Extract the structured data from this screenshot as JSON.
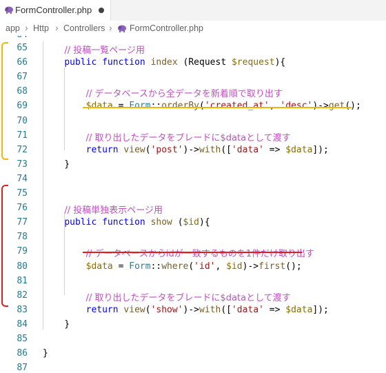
{
  "tab": {
    "label": "FormController.php"
  },
  "breadcrumb": {
    "items": [
      "app",
      "Http",
      "Controllers",
      "FormController.php"
    ]
  },
  "top_partial": "84",
  "lines": [
    {
      "num": "65",
      "tokens": [
        {
          "t": "    "
        },
        {
          "t": "// 投稿一覧ページ用",
          "c": "comment"
        }
      ]
    },
    {
      "num": "66",
      "tokens": [
        {
          "t": "    "
        },
        {
          "t": "public",
          "c": "kw"
        },
        {
          "t": " "
        },
        {
          "t": "function",
          "c": "kw"
        },
        {
          "t": " "
        },
        {
          "t": "index",
          "c": "func"
        },
        {
          "t": " ("
        },
        {
          "t": "Request",
          "c": "plain"
        },
        {
          "t": " "
        },
        {
          "t": "$request",
          "c": "var"
        },
        {
          "t": "){"
        }
      ]
    },
    {
      "num": "67",
      "tokens": []
    },
    {
      "num": "68",
      "tokens": [
        {
          "t": "        "
        },
        {
          "t": "// データベースから全データを新着順で取り出す",
          "c": "comment"
        }
      ]
    },
    {
      "num": "69",
      "tokens": [
        {
          "t": "        "
        },
        {
          "t": "$data",
          "c": "var"
        },
        {
          "t": " = "
        },
        {
          "t": "Form",
          "c": "cls"
        },
        {
          "t": "::"
        },
        {
          "t": "orderBy",
          "c": "func"
        },
        {
          "t": "("
        },
        {
          "t": "'created_at'",
          "c": "str"
        },
        {
          "t": ", "
        },
        {
          "t": "'desc'",
          "c": "str"
        },
        {
          "t": ")->"
        },
        {
          "t": "get",
          "c": "func"
        },
        {
          "t": "();"
        }
      ]
    },
    {
      "num": "70",
      "tokens": []
    },
    {
      "num": "71",
      "tokens": [
        {
          "t": "        "
        },
        {
          "t": "// 取り出したデータをブレードに$dataとして渡す",
          "c": "comment"
        }
      ]
    },
    {
      "num": "72",
      "tokens": [
        {
          "t": "        "
        },
        {
          "t": "return",
          "c": "kw"
        },
        {
          "t": " "
        },
        {
          "t": "view",
          "c": "func"
        },
        {
          "t": "("
        },
        {
          "t": "'post'",
          "c": "str"
        },
        {
          "t": ")->"
        },
        {
          "t": "with",
          "c": "func"
        },
        {
          "t": "(["
        },
        {
          "t": "'data'",
          "c": "str"
        },
        {
          "t": " => "
        },
        {
          "t": "$data",
          "c": "var"
        },
        {
          "t": "]);"
        }
      ]
    },
    {
      "num": "73",
      "tokens": [
        {
          "t": "    }"
        }
      ]
    },
    {
      "num": "74",
      "tokens": []
    },
    {
      "num": "75",
      "tokens": []
    },
    {
      "num": "76",
      "tokens": [
        {
          "t": "    "
        },
        {
          "t": "// 投稿単独表示ページ用",
          "c": "comment"
        }
      ]
    },
    {
      "num": "77",
      "tokens": [
        {
          "t": "    "
        },
        {
          "t": "public",
          "c": "kw"
        },
        {
          "t": " "
        },
        {
          "t": "function",
          "c": "kw"
        },
        {
          "t": " "
        },
        {
          "t": "show",
          "c": "func"
        },
        {
          "t": " ("
        },
        {
          "t": "$id",
          "c": "var"
        },
        {
          "t": "){"
        }
      ]
    },
    {
      "num": "78",
      "tokens": []
    },
    {
      "num": "79",
      "tokens": [
        {
          "t": "        "
        },
        {
          "t": "// データベースからidが一致するものを1件だけ取り出す",
          "c": "comment"
        }
      ]
    },
    {
      "num": "80",
      "tokens": [
        {
          "t": "        "
        },
        {
          "t": "$data",
          "c": "var"
        },
        {
          "t": " = "
        },
        {
          "t": "Form",
          "c": "cls"
        },
        {
          "t": "::"
        },
        {
          "t": "where",
          "c": "func"
        },
        {
          "t": "("
        },
        {
          "t": "'id'",
          "c": "str"
        },
        {
          "t": ", "
        },
        {
          "t": "$id",
          "c": "var"
        },
        {
          "t": ")->"
        },
        {
          "t": "first",
          "c": "func"
        },
        {
          "t": "();"
        }
      ]
    },
    {
      "num": "81",
      "tokens": []
    },
    {
      "num": "82",
      "tokens": [
        {
          "t": "        "
        },
        {
          "t": "// 取り出したデータをブレードに$dataとして渡す",
          "c": "comment"
        }
      ]
    },
    {
      "num": "83",
      "tokens": [
        {
          "t": "        "
        },
        {
          "t": "return",
          "c": "kw"
        },
        {
          "t": " "
        },
        {
          "t": "view",
          "c": "func"
        },
        {
          "t": "("
        },
        {
          "t": "'show'",
          "c": "str"
        },
        {
          "t": ")->"
        },
        {
          "t": "with",
          "c": "func"
        },
        {
          "t": "(["
        },
        {
          "t": "'data'",
          "c": "str"
        },
        {
          "t": " => "
        },
        {
          "t": "$data",
          "c": "var"
        },
        {
          "t": "]);"
        }
      ]
    },
    {
      "num": "84",
      "tokens": [
        {
          "t": "    }"
        }
      ]
    },
    {
      "num": "85",
      "tokens": []
    },
    {
      "num": "86",
      "tokens": [
        {
          "t": "}"
        }
      ]
    },
    {
      "num": "87",
      "tokens": []
    }
  ],
  "colors": {
    "comment": "#c24ec2",
    "keyword": "#0000ff",
    "function": "#795e26",
    "variable": "#8a6d00",
    "string": "#a31515",
    "class": "#267f99",
    "line_number": "#237893",
    "highlight_yellow": "#f2b800",
    "highlight_red": "#e01e1e"
  },
  "annotations": {
    "yellow_bracket_range": [
      "65",
      "73"
    ],
    "red_bracket_range": [
      "76",
      "84"
    ],
    "yellow_underline_line": "69",
    "red_underline_line": "80"
  }
}
